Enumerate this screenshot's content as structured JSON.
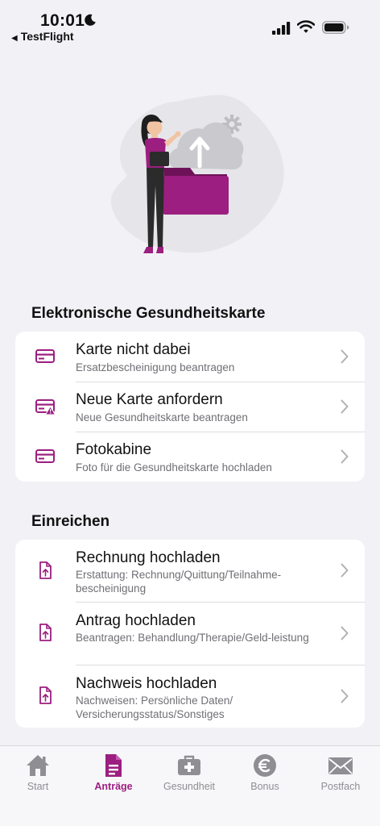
{
  "status": {
    "time": "10:01",
    "back_app": "TestFlight"
  },
  "colors": {
    "accent": "#9c1e80",
    "inactive": "#8e8e93",
    "background": "#f2f1f6"
  },
  "sections": [
    {
      "title": "Elektronische Gesundheitskarte",
      "items": [
        {
          "title": "Karte nicht dabei",
          "subtitle": "Ersatzbescheinigung beantragen",
          "icon": "card-icon"
        },
        {
          "title": "Neue Karte anfordern",
          "subtitle": "Neue Gesundheitskarte beantragen",
          "icon": "card-warning-icon"
        },
        {
          "title": "Fotokabine",
          "subtitle": "Foto für die Gesundheitskarte hochladen",
          "icon": "card-icon"
        }
      ]
    },
    {
      "title": "Einreichen",
      "items": [
        {
          "title": "Rechnung hochladen",
          "subtitle": "Erstattung: Rechnung/Quittung/Teilnahme-bescheinigung",
          "icon": "document-upload-icon"
        },
        {
          "title": "Antrag hochladen",
          "subtitle": "Beantragen: Behandlung/Therapie/Geld-leistung",
          "icon": "document-upload-icon"
        },
        {
          "title": "Nachweis hochladen",
          "subtitle": "Nachweisen: Persönliche Daten/ Versicherungsstatus/Sonstiges",
          "icon": "document-upload-icon"
        }
      ]
    }
  ],
  "tabs": [
    {
      "label": "Start",
      "icon": "home-icon",
      "active": false
    },
    {
      "label": "Anträge",
      "icon": "document-icon",
      "active": true
    },
    {
      "label": "Gesundheit",
      "icon": "medical-case-icon",
      "active": false
    },
    {
      "label": "Bonus",
      "icon": "euro-coin-icon",
      "active": false
    },
    {
      "label": "Postfach",
      "icon": "mail-icon",
      "active": false
    }
  ]
}
